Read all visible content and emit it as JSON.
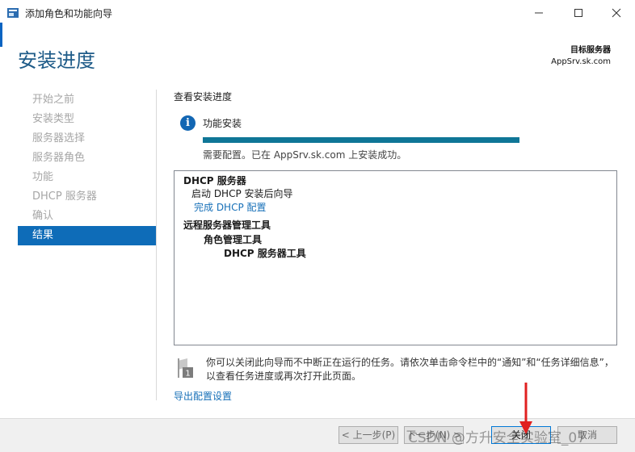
{
  "window": {
    "title": "添加角色和功能向导"
  },
  "header": {
    "page_title": "安装进度",
    "target_label": "目标服务器",
    "target_server": "AppSrv.sk.com"
  },
  "nav": {
    "items": [
      {
        "label": "开始之前"
      },
      {
        "label": "安装类型"
      },
      {
        "label": "服务器选择"
      },
      {
        "label": "服务器角色"
      },
      {
        "label": "功能"
      },
      {
        "label": "DHCP 服务器"
      },
      {
        "label": "确认"
      },
      {
        "label": "结果"
      }
    ],
    "active_index": 7
  },
  "content": {
    "section_label": "查看安装进度",
    "feature_label": "功能安装",
    "progress": 1.0,
    "status": "需要配置。已在 AppSrv.sk.com 上安装成功。",
    "results": [
      {
        "text": "DHCP 服务器",
        "style": "bold",
        "indent": 0
      },
      {
        "text": "启动 DHCP 安装后向导",
        "style": "normal",
        "indent": 1
      },
      {
        "text": "完成 DHCP 配置",
        "style": "link",
        "indent": 2
      },
      {
        "text": "远程服务器管理工具",
        "style": "bold",
        "indent": 0
      },
      {
        "text": "角色管理工具",
        "style": "bold",
        "indent": 3
      },
      {
        "text": "DHCP 服务器工具",
        "style": "bold",
        "indent": 4
      }
    ],
    "note": "你可以关闭此向导而不中断正在运行的任务。请依次单击命令栏中的“通知”和“任务详细信息”，以查看任务进度或再次打开此页面。",
    "note_badge": "1",
    "export_link": "导出配置设置"
  },
  "footer": {
    "prev": "< 上一步(P)",
    "next": "下一步(N) >",
    "close": "关闭",
    "cancel": "取消"
  },
  "watermark": "CSDN @方升安全实验室_07",
  "colors": {
    "accent": "#1e5b88",
    "nav_active": "#0e6cb8",
    "progress": "#0f7697",
    "link": "#1770b8"
  }
}
